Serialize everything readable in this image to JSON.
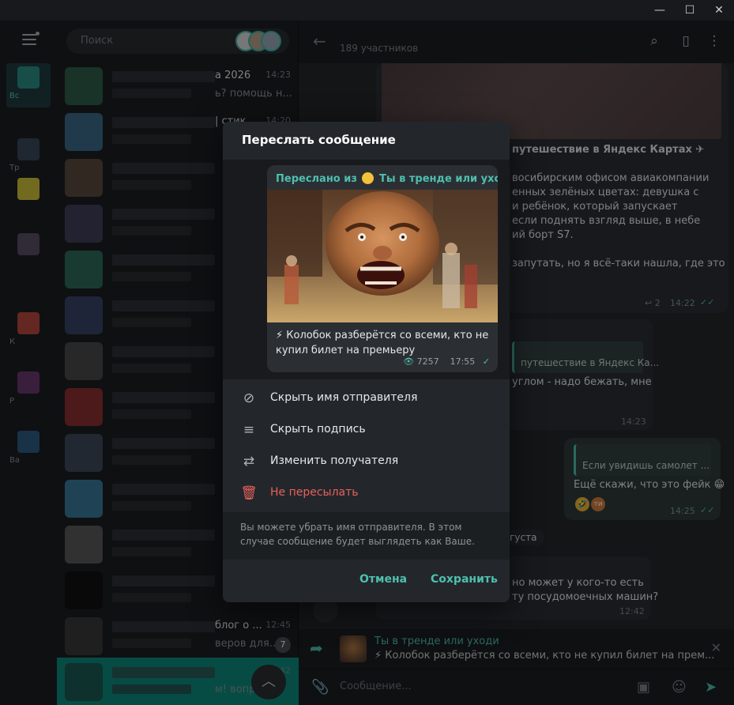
{
  "window": {
    "minimize": "—",
    "maximize": "☐",
    "close": "✕"
  },
  "sidebar": {
    "folders": [
      {
        "label": "Вс",
        "color": "#2b8f86",
        "active": true
      },
      {
        "label": "Тр",
        "color": "#3a4a59"
      },
      {
        "label": "",
        "color": "#cfc23a"
      },
      {
        "label": "",
        "color": "#5a4d64"
      },
      {
        "label": "К",
        "color": "#b9473e"
      },
      {
        "label": "Р",
        "color": "#6a3a6e"
      },
      {
        "label": "Ва",
        "color": "#2d5c84"
      }
    ]
  },
  "chatlist": {
    "search_placeholder": "Поиск",
    "chats": [
      {
        "title": "а 2026",
        "msg": "ь? помощь н...",
        "time": "14:23",
        "color": "#2f5d4a"
      },
      {
        "title": "| стик...",
        "msg": "",
        "time": "14:20",
        "color": "#3b6b8a"
      },
      {
        "title": "",
        "msg": "",
        "time": "",
        "color": "#5a4a3e"
      },
      {
        "title": "",
        "msg": "",
        "time": "",
        "color": "#3e3e5a"
      },
      {
        "title": "",
        "msg": "",
        "time": "",
        "color": "#2f6a5a"
      },
      {
        "title": "",
        "msg": "",
        "time": "",
        "color": "#3a4466"
      },
      {
        "title": "",
        "msg": "",
        "time": "",
        "color": "#4a4a4a"
      },
      {
        "title": "",
        "msg": "",
        "time": "",
        "color": "#8a3030"
      },
      {
        "title": "",
        "msg": "",
        "time": "",
        "color": "#3e4a5a"
      },
      {
        "title": "",
        "msg": "",
        "time": "",
        "color": "#3a7a9a"
      },
      {
        "title": "",
        "msg": "",
        "time": "",
        "color": "#5a5a5a"
      },
      {
        "title": "",
        "msg": "",
        "time": "",
        "color": "#111111"
      },
      {
        "title": "блог о ...",
        "msg": "веров для...",
        "time": "12:45",
        "badge": "7",
        "color": "#3a3a3a"
      },
      {
        "title": "",
        "msg": "м! вопр...",
        "time": "42",
        "color": "#1a5a55",
        "selected": true
      }
    ],
    "scroll_up": "︿"
  },
  "header": {
    "title": "",
    "subtitle": "189 участников"
  },
  "messages": {
    "m1_title": "путешествие в Яндекс Картах ✈",
    "m1_lines": [
      "восибирским офисом авиакомпании",
      "енных зелёных цветах: девушка с",
      "и ребёнок, который запускает",
      "если поднять взгляд выше, в небе",
      "ий борт S7."
    ],
    "m1_line6": "запутать, но я всё-таки нашла, где это",
    "m1_replies": "↩ 2",
    "m1_time": "14:22",
    "m2_quote": "путешествие в Яндекс Ка...",
    "m2_text": "углом - надо бежать, мне",
    "m2_time": "14:23",
    "m3_quote": "Если увидишь самолет ...",
    "m3_text": "Ещё скажи, что это фейк 😁",
    "m3_time": "14:25",
    "date_pill": "вгуста",
    "m4_line1": "но может у кого-то есть",
    "m4_line2": "ту посудомоечных машин?",
    "m4_time": "12:42"
  },
  "forward_bar": {
    "name": "Ты в тренде или уходи",
    "text": "⚡ Колобок разберётся со всеми, кто не купил билет на прем..."
  },
  "composer": {
    "placeholder": "Сообщение..."
  },
  "dialog": {
    "title": "Переслать сообщение",
    "forwarded_from_prefix": "Переслано из",
    "channel_name": "Ты в тренде или уходи",
    "caption": "⚡ Колобок разберётся со всеми, кто не купил билет на премьеру",
    "views": "7257",
    "time": "17:55",
    "options": [
      {
        "label": "Скрыть имя отправителя",
        "icon": "person-off-icon"
      },
      {
        "label": "Скрыть подпись",
        "icon": "text-off-icon"
      },
      {
        "label": "Изменить получателя",
        "icon": "swap-icon"
      },
      {
        "label": "Не пересылать",
        "icon": "trash-icon",
        "danger": true
      }
    ],
    "hint": "Вы можете убрать имя отправителя. В этом случае сообщение будет выглядеть как Ваше.",
    "cancel": "Отмена",
    "save": "Сохранить"
  },
  "colors": {
    "accent": "#4fbfae",
    "danger": "#e8605c",
    "dialog_bg": "#23272b"
  }
}
